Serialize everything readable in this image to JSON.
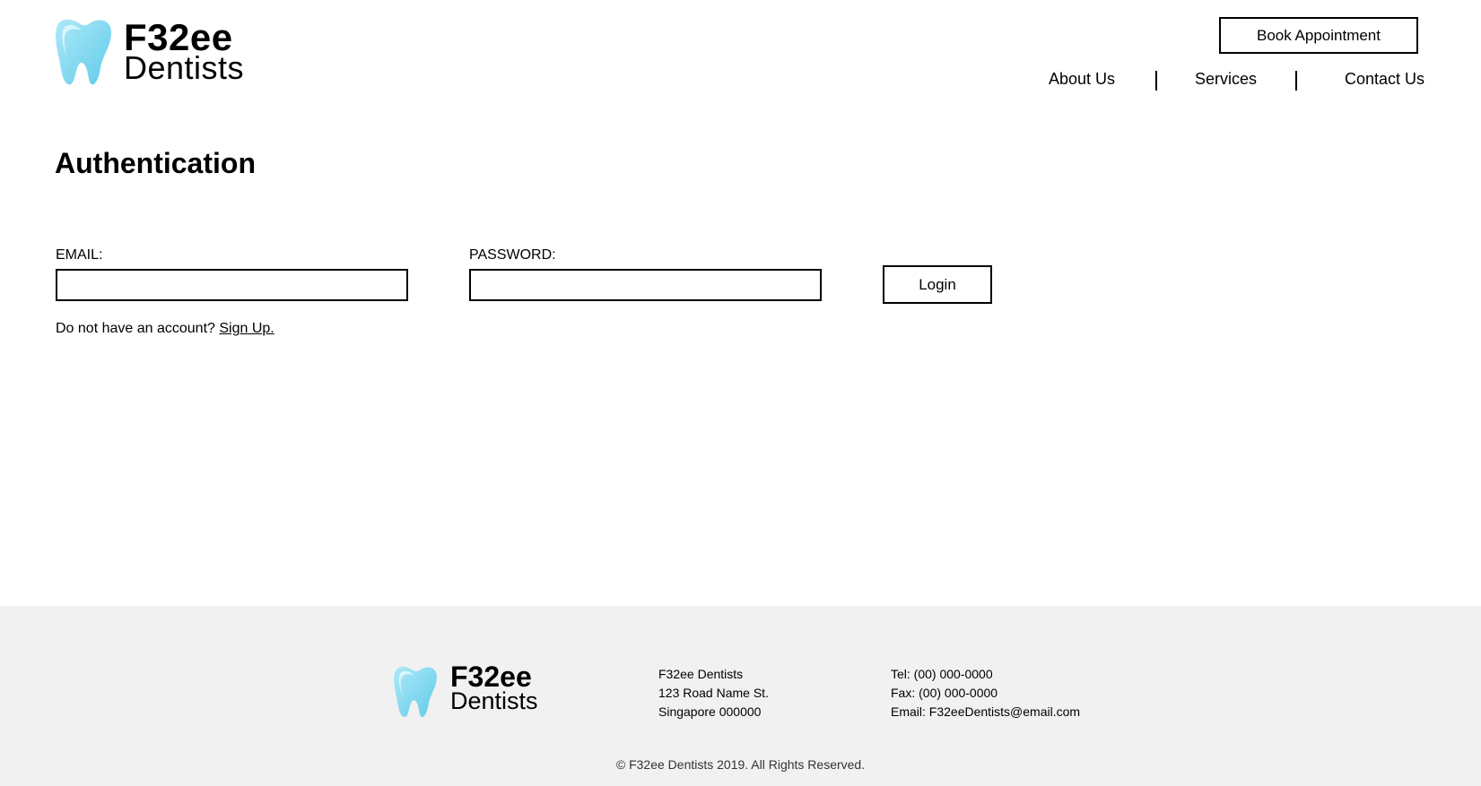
{
  "brand": {
    "name": "F32ee",
    "sub": "Dentists",
    "accent_color": "#7fd8f0"
  },
  "header": {
    "book_label": "Book Appointment",
    "nav": {
      "about": "About Us",
      "services": "Services",
      "contact": "Contact Us"
    }
  },
  "page": {
    "title": "Authentication"
  },
  "form": {
    "email_label": "EMAIL:",
    "email_value": "",
    "password_label": "PASSWORD:",
    "password_value": "",
    "login_label": "Login",
    "signup_prompt": "Do not have an account?",
    "signup_link": "Sign Up."
  },
  "footer": {
    "address": {
      "line1": "F32ee Dentists",
      "line2": "123 Road Name St.",
      "line3": "Singapore 000000"
    },
    "contact": {
      "tel": "Tel: (00) 000-0000",
      "fax": "Fax: (00) 000-0000",
      "email": "Email: F32eeDentists@email.com"
    },
    "copyright": "© F32ee Dentists 2019. All Rights Reserved."
  }
}
